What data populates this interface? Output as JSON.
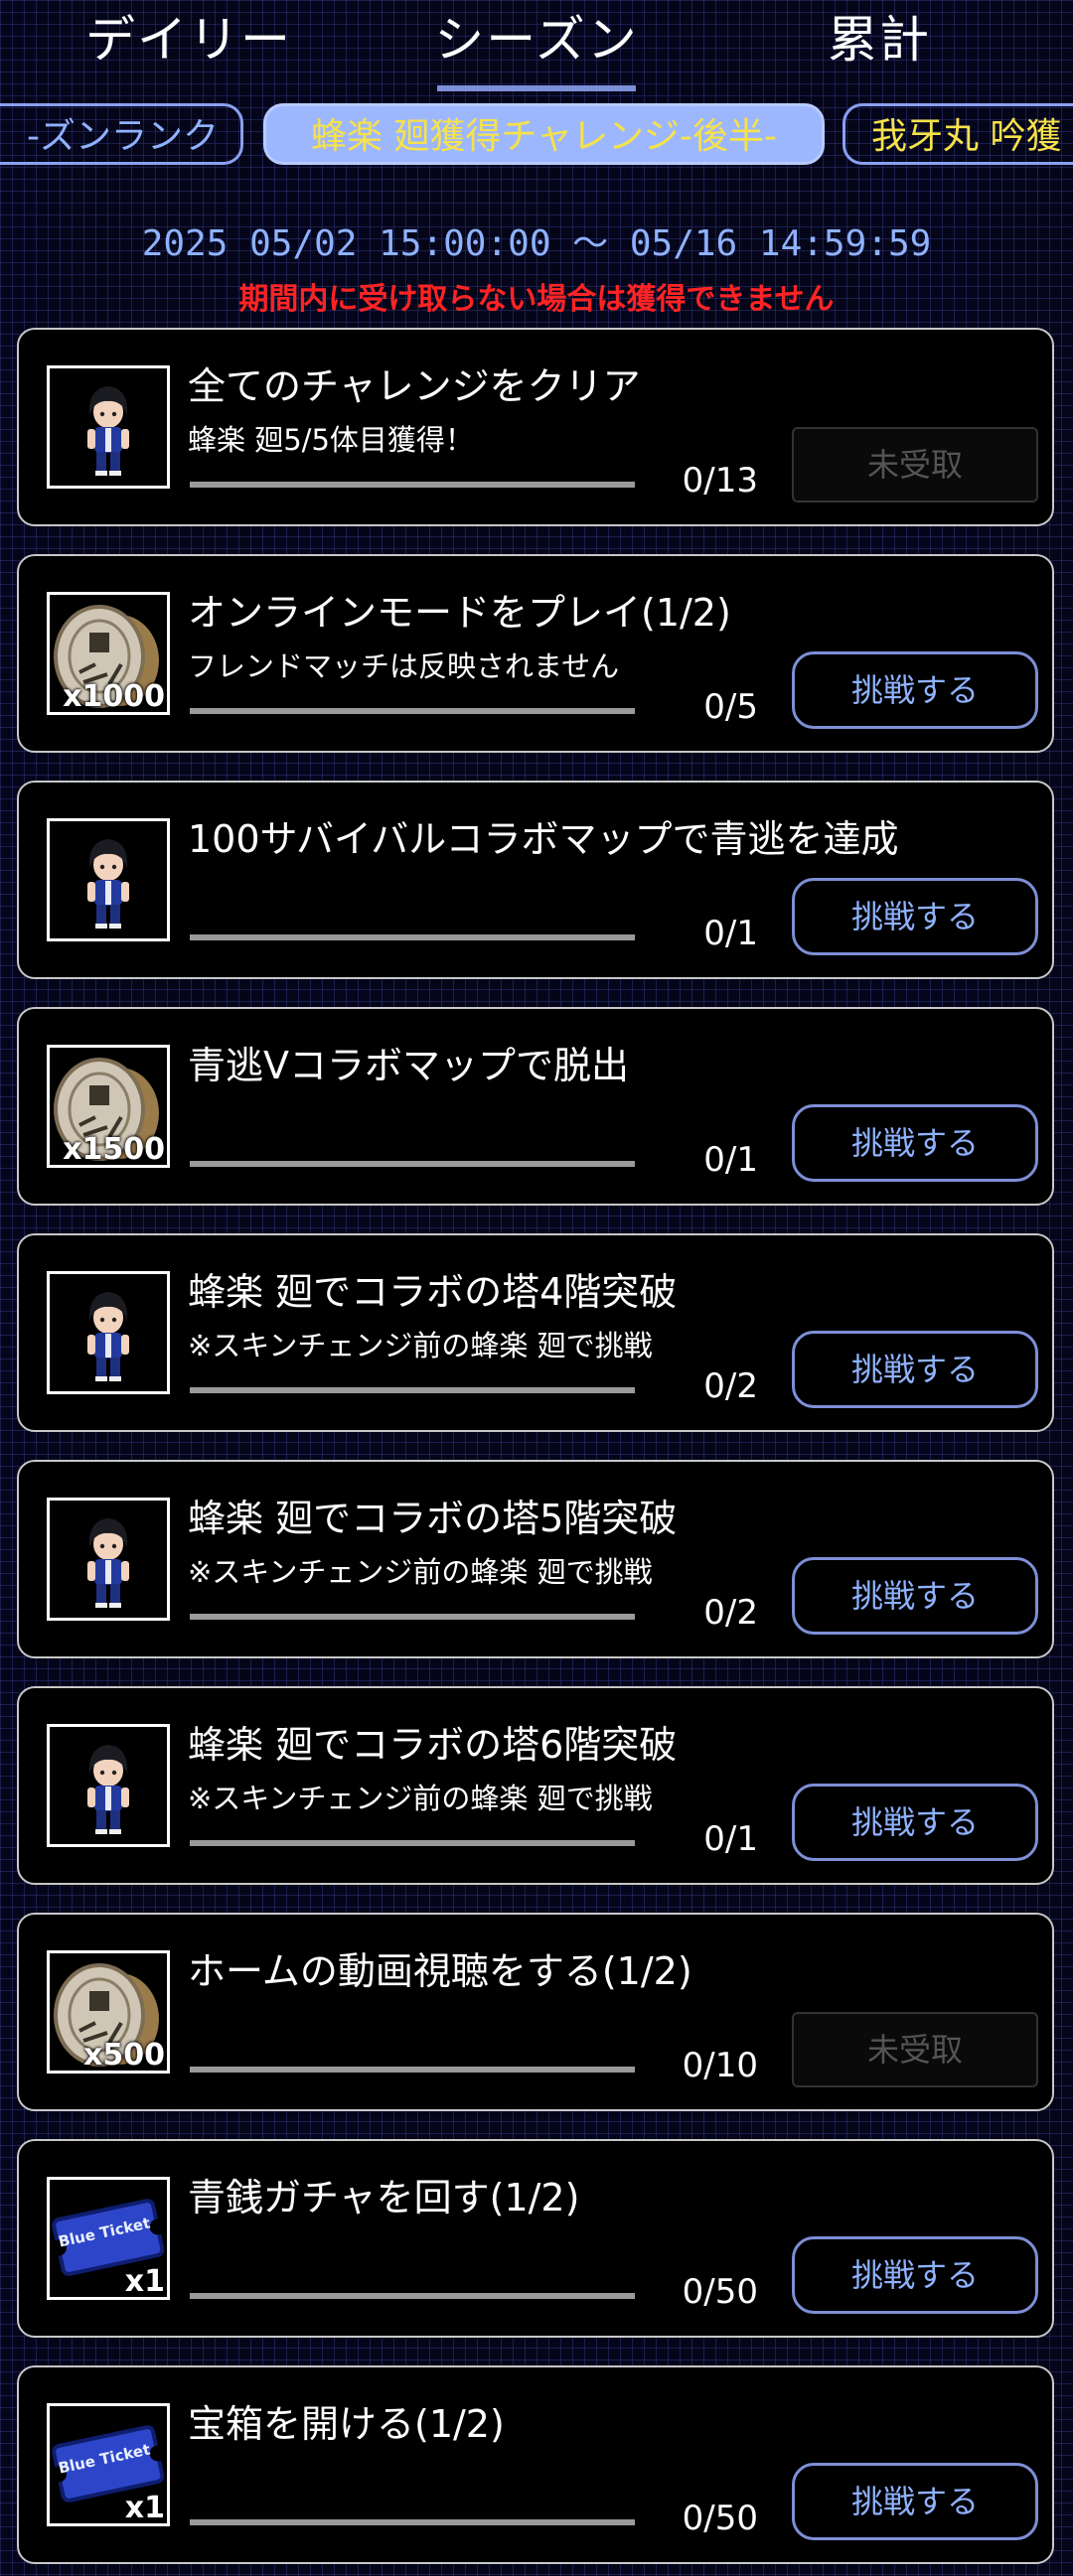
{
  "tabs": {
    "daily": "デイリー",
    "season": "シーズン",
    "total": "累計"
  },
  "categories": [
    {
      "label": "-ズンランク"
    },
    {
      "label": "蜂楽 廻獲得チャレンジ-後半-"
    },
    {
      "label": "我牙丸 吟獲"
    }
  ],
  "period": "2025 05/02 15:00:00 ～ 05/16 14:59:59",
  "warning": "期間内に受け取らない場合は獲得できません",
  "challenges": [
    {
      "title": "全てのチャレンジをクリア",
      "sub": "蜂楽 廻5/5体目獲得！",
      "progress": "0/13",
      "reward": "character-icon",
      "qty": "",
      "button": "未受取",
      "state": "disabled"
    },
    {
      "title": "オンラインモードをプレイ(1/2)",
      "sub": "フレンドマッチは反映されません",
      "progress": "0/5",
      "reward": "coin-icon",
      "qty": "x1000",
      "button": "挑戦する",
      "state": "challenge"
    },
    {
      "title": "100サバイバルコラボマップで青逃を達成",
      "sub": "",
      "progress": "0/1",
      "reward": "character-icon",
      "qty": "",
      "button": "挑戦する",
      "state": "challenge"
    },
    {
      "title": "青逃Vコラボマップで脱出",
      "sub": "",
      "progress": "0/1",
      "reward": "coin-icon",
      "qty": "x1500",
      "button": "挑戦する",
      "state": "challenge"
    },
    {
      "title": "蜂楽 廻でコラボの塔4階突破",
      "sub": "※スキンチェンジ前の蜂楽 廻で挑戦",
      "progress": "0/2",
      "reward": "character-icon",
      "qty": "",
      "button": "挑戦する",
      "state": "challenge"
    },
    {
      "title": "蜂楽 廻でコラボの塔5階突破",
      "sub": "※スキンチェンジ前の蜂楽 廻で挑戦",
      "progress": "0/2",
      "reward": "character-icon",
      "qty": "",
      "button": "挑戦する",
      "state": "challenge"
    },
    {
      "title": "蜂楽 廻でコラボの塔6階突破",
      "sub": "※スキンチェンジ前の蜂楽 廻で挑戦",
      "progress": "0/1",
      "reward": "character-icon",
      "qty": "",
      "button": "挑戦する",
      "state": "challenge"
    },
    {
      "title": "ホームの動画視聴をする(1/2)",
      "sub": "",
      "progress": "0/10",
      "reward": "coin-icon",
      "qty": "x500",
      "button": "未受取",
      "state": "disabled"
    },
    {
      "title": "青銭ガチャを回す(1/2)",
      "sub": "",
      "progress": "0/50",
      "reward": "ticket-icon",
      "ticket_text": "Blue Ticket",
      "qty": "x1",
      "button": "挑戦する",
      "state": "challenge"
    },
    {
      "title": "宝箱を開ける(1/2)",
      "sub": "",
      "progress": "0/50",
      "reward": "ticket-icon",
      "ticket_text": "Blue Ticket",
      "qty": "x1",
      "button": "挑戦する",
      "state": "challenge"
    }
  ]
}
